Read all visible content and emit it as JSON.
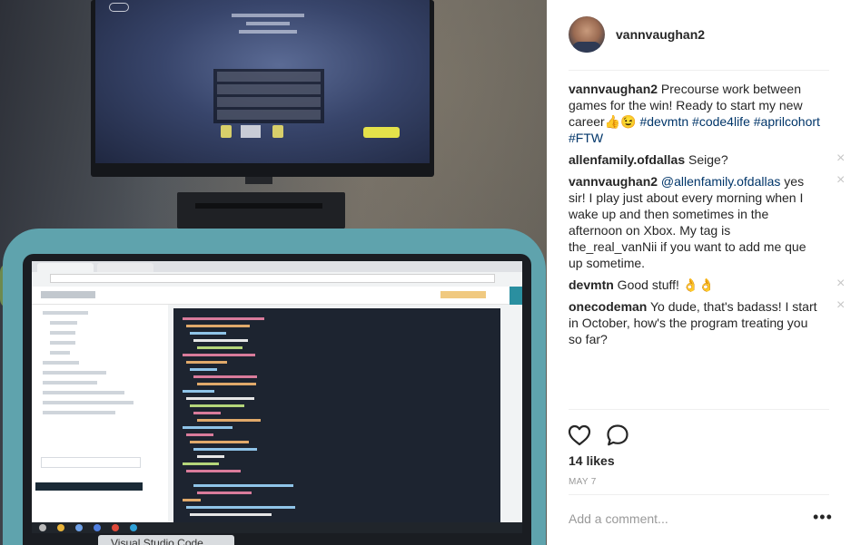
{
  "post": {
    "username": "vannvaughan2",
    "caption": {
      "author": "vannvaughan2",
      "text": " Precourse work between games for the win! Ready to start my new career👍😉",
      "hashtags": [
        "#devmtn",
        "#code4life",
        "#aprilcohort",
        "#FTW"
      ]
    },
    "comments": [
      {
        "author": "allenfamily.ofdallas",
        "mention": "",
        "text": " Seige?"
      },
      {
        "author": "vannvaughan2",
        "mention": "@allenfamily.ofdallas",
        "text": " yes sir! I play just about every morning when I wake up and then sometimes in the afternoon on Xbox. My tag is the_real_vanNii if you want to add me que up sometime."
      },
      {
        "author": "devmtn",
        "mention": "",
        "text": " Good stuff! 👌👌"
      },
      {
        "author": "onecodeman",
        "mention": "",
        "text": " Yo dude, that's badass! I start in October, how's the program treating you so far?"
      }
    ],
    "likes": "14 likes",
    "date": "MAY 7",
    "add_comment_placeholder": "Add a comment...",
    "more_label": "•••",
    "remove_label": "×"
  },
  "photo": {
    "taskbar_tooltip": "Visual Studio Code"
  },
  "icons": {
    "like": "heart-outline-icon",
    "comment": "speech-bubble-icon",
    "remove": "close-icon",
    "more": "ellipsis-icon"
  },
  "colors": {
    "text": "#262626",
    "link": "#003569",
    "muted": "#999999",
    "divider": "#efefef"
  }
}
